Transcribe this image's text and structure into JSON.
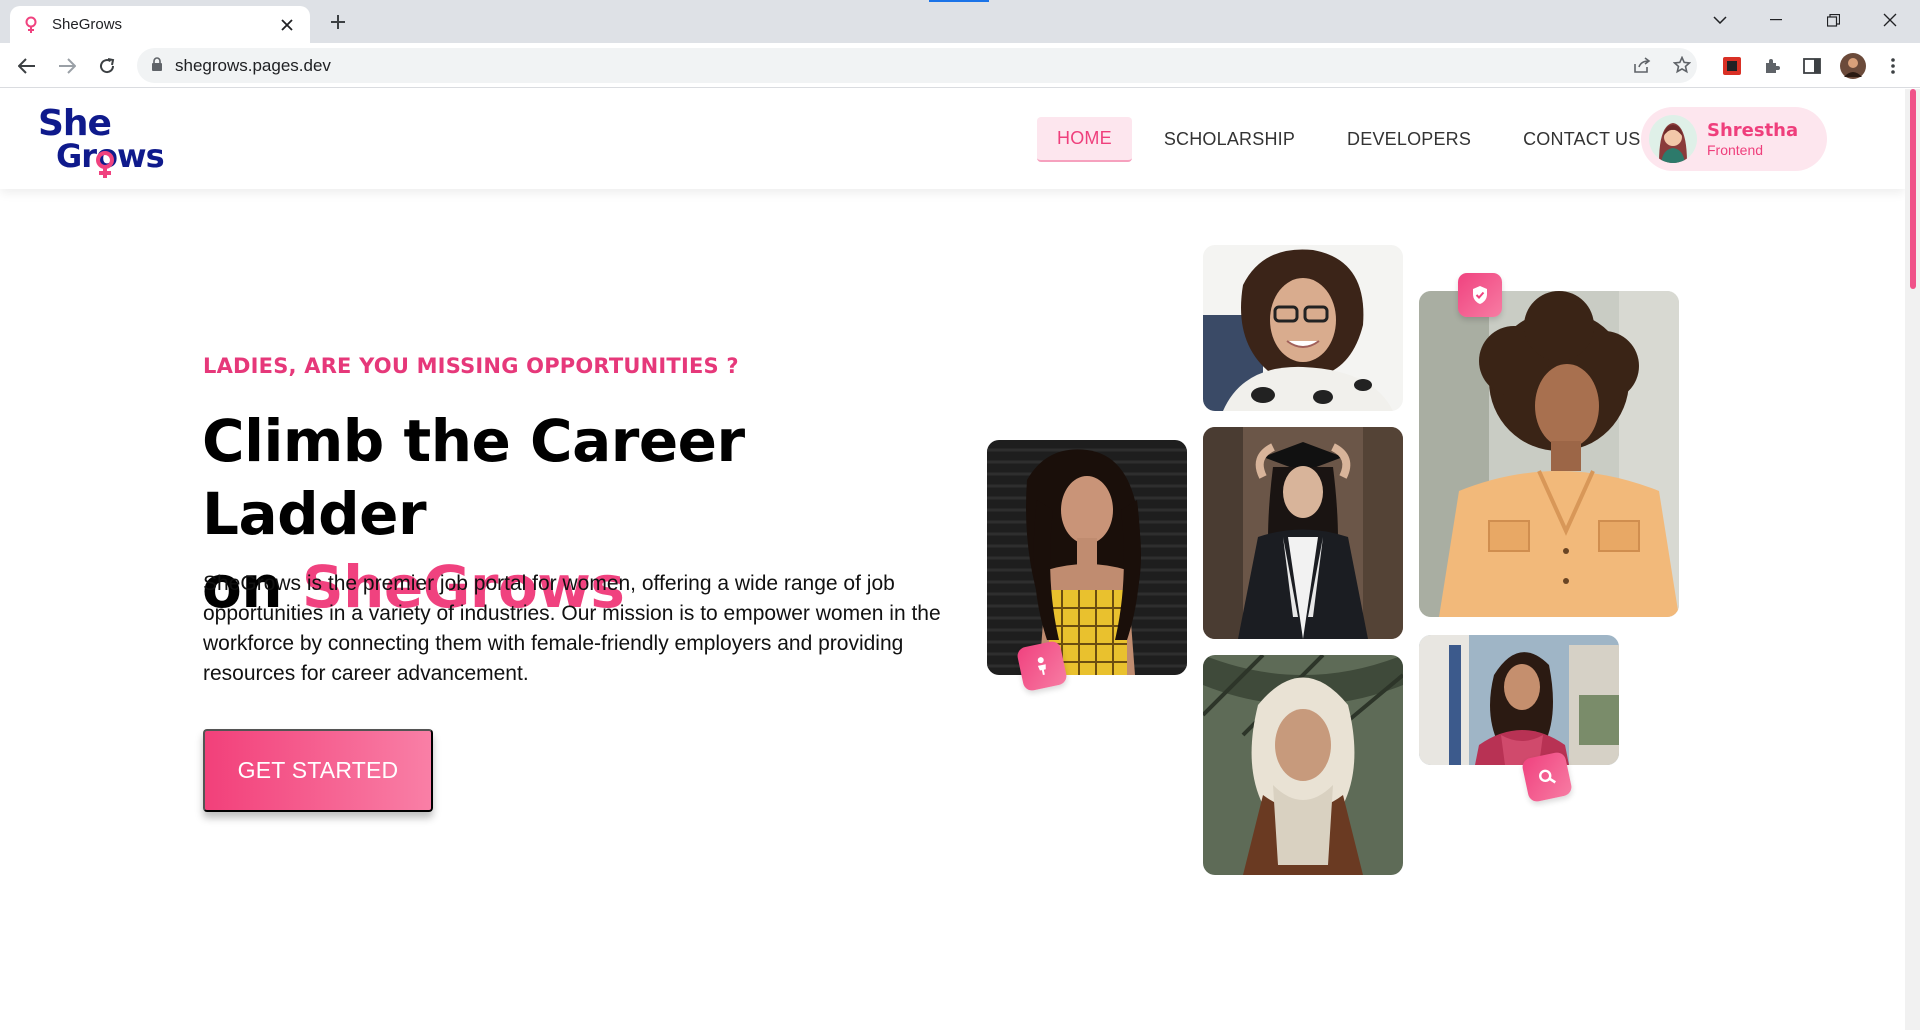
{
  "browser": {
    "tab_title": "SheGrows",
    "url": "shegrows.pages.dev"
  },
  "site": {
    "logo": {
      "line1": "She",
      "line2": "Grows"
    },
    "nav": {
      "items": [
        {
          "label": "HOME",
          "active": true
        },
        {
          "label": "SCHOLARSHIP",
          "active": false
        },
        {
          "label": "DEVELOPERS",
          "active": false
        },
        {
          "label": "CONTACT US",
          "active": false
        }
      ]
    },
    "profile": {
      "name": "Shrestha",
      "role": "Frontend"
    }
  },
  "hero": {
    "eyebrow": "LADIES, ARE YOU MISSING OPPORTUNITIES ?",
    "title_line1": "Climb the Career Ladder",
    "title_on": "on",
    "title_brand": "SheGrows",
    "description": "SheGrows is the premier job portal for women, offering a wide range of job opportunities in a variety of industries. Our mission is to empower women in the workforce by connecting them with female-friendly employers and providing resources for career advancement.",
    "cta_label": "GET STARTED"
  },
  "photos": [
    {
      "name": "woman-yellow-top",
      "badge_icon": "person-icon"
    },
    {
      "name": "woman-glasses-smiling"
    },
    {
      "name": "woman-graduation"
    },
    {
      "name": "woman-hijab"
    },
    {
      "name": "woman-curly-hair",
      "badge_icon": "shield-check-icon"
    },
    {
      "name": "woman-street",
      "badge_icon": "search-icon"
    }
  ],
  "colors": {
    "brand_pink": "#f0427f",
    "brand_navy": "#0f1a8c",
    "nav_active_bg": "#fde6ee"
  }
}
